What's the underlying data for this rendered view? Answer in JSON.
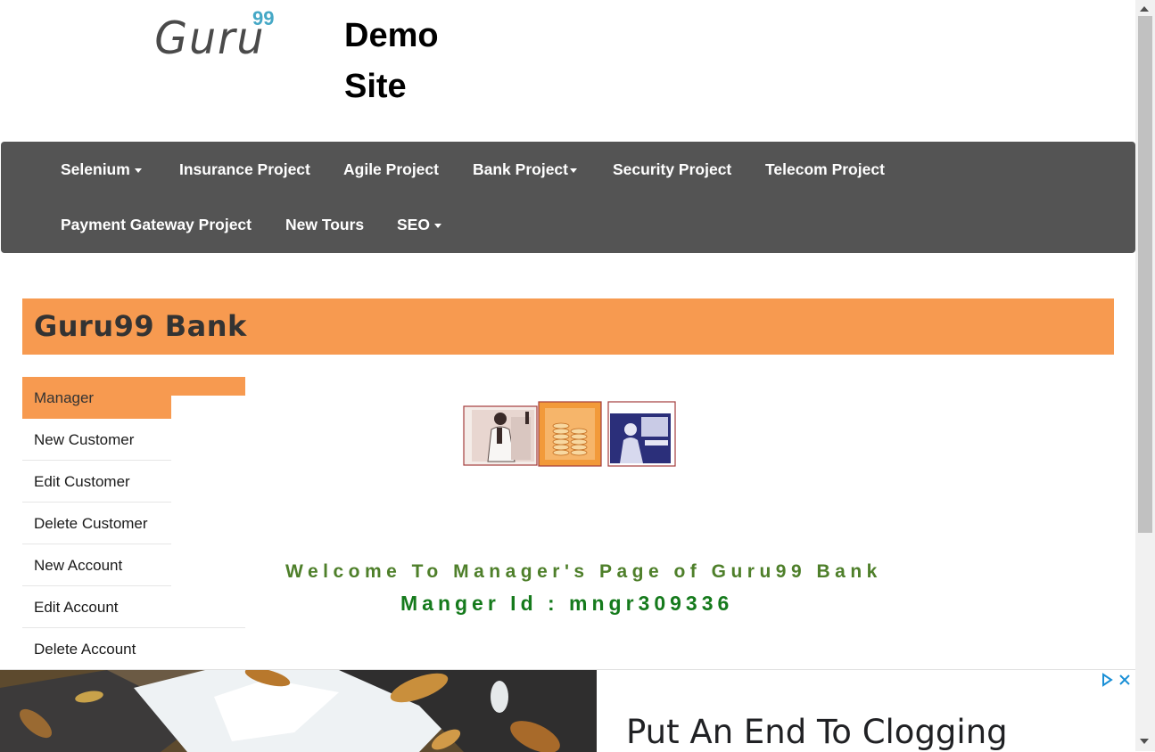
{
  "header": {
    "logo_text": "Guru",
    "logo_sup": "99",
    "site_title": "Demo Site"
  },
  "nav": {
    "row1": [
      {
        "label": "Selenium",
        "dropdown": true
      },
      {
        "label": "Insurance Project",
        "dropdown": false
      },
      {
        "label": "Agile Project",
        "dropdown": false
      },
      {
        "label": "Bank Project",
        "dropdown": true
      },
      {
        "label": "Security Project",
        "dropdown": false
      },
      {
        "label": "Telecom Project",
        "dropdown": false
      }
    ],
    "row2": [
      {
        "label": "Payment Gateway Project",
        "dropdown": false
      },
      {
        "label": "New Tours",
        "dropdown": false
      },
      {
        "label": "SEO",
        "dropdown": true
      }
    ]
  },
  "banner": {
    "title": "Guru99 Bank"
  },
  "sidebar": {
    "items": [
      {
        "label": "Manager",
        "active": true
      },
      {
        "label": "New Customer"
      },
      {
        "label": "Edit Customer"
      },
      {
        "label": "Delete Customer"
      },
      {
        "label": "New Account"
      },
      {
        "label": "Edit Account"
      },
      {
        "label": "Delete Account"
      }
    ]
  },
  "main": {
    "welcome": "Welcome To Manager's Page of Guru99 Bank",
    "manager_id": "Manger Id : mngr309336"
  },
  "ad": {
    "headline": "Put An End To Clogging"
  },
  "colors": {
    "nav_bg": "#545454",
    "accent": "#f79a50",
    "welcome_green": "#4e7f2a",
    "id_green": "#157a1c"
  }
}
